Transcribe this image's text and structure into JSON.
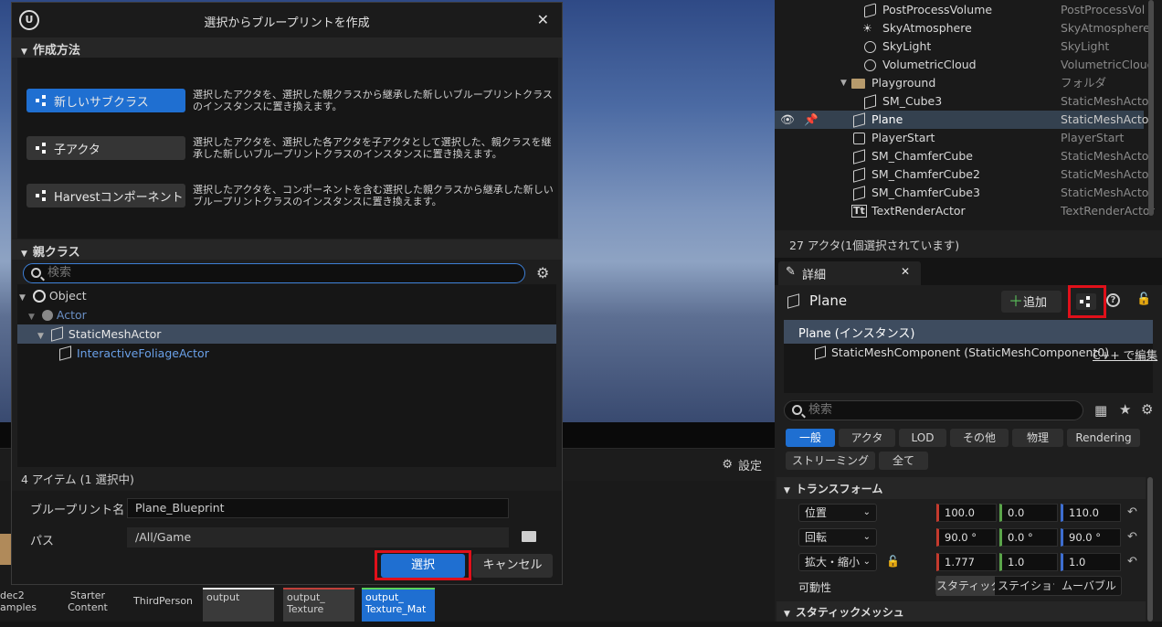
{
  "viewport": {
    "settings_label": "設定"
  },
  "content_tiles": [
    "dec2\namples",
    "Starter\nContent",
    "ThirdPerson",
    "output",
    "output_\nTexture",
    "output_\nTexture_Mat"
  ],
  "dialog": {
    "title": "選択からブループリントを作成",
    "section_method": "作成方法",
    "methods": [
      {
        "label": "新しいサブクラス",
        "desc": "選択したアクタを、選択した親クラスから継承した新しいブループリントクラスのインスタンスに置き換えます。"
      },
      {
        "label": "子アクタ",
        "desc": "選択したアクタを、選択した各アクタを子アクタとして選択した、親クラスを継承した新しいブループリントクラスのインスタンスに置き換えます。"
      },
      {
        "label": "Harvestコンポーネント",
        "desc": "選択したアクタを、コンポーネントを含む選択した親クラスから継承した新しいブループリントクラスのインスタンスに置き換えます。"
      }
    ],
    "section_parent": "親クラス",
    "search_placeholder": "検索",
    "tree": [
      "Object",
      "Actor",
      "StaticMeshActor",
      "InteractiveFoliageActor"
    ],
    "item_count": "4 アイテム (1 選択中)",
    "bp_name_label": "ブループリント名",
    "bp_name_value": "Plane_Blueprint",
    "path_label": "パス",
    "path_value": "/All/Game",
    "select_label": "選択",
    "cancel_label": "キャンセル"
  },
  "outliner": {
    "rows": [
      {
        "name": "PostProcessVolume",
        "type": "PostProcessVol"
      },
      {
        "name": "SkyAtmosphere",
        "type": "SkyAtmosphere"
      },
      {
        "name": "SkyLight",
        "type": "SkyLight"
      },
      {
        "name": "VolumetricCloud",
        "type": "VolumetricCloud"
      },
      {
        "name": "Playground",
        "type": "フォルダ"
      },
      {
        "name": "SM_Cube3",
        "type": "StaticMeshActor"
      },
      {
        "name": "Plane",
        "type": "StaticMeshActor"
      },
      {
        "name": "PlayerStart",
        "type": "PlayerStart"
      },
      {
        "name": "SM_ChamferCube",
        "type": "StaticMeshActor"
      },
      {
        "name": "SM_ChamferCube2",
        "type": "StaticMeshActor"
      },
      {
        "name": "SM_ChamferCube3",
        "type": "StaticMeshActor"
      },
      {
        "name": "TextRenderActor",
        "type": "TextRenderActor"
      }
    ],
    "status": "27 アクタ(1個選択されています)"
  },
  "details": {
    "tab_label": "詳細",
    "actor_name": "Plane",
    "add_label": "追加",
    "instance_label": "Plane (インスタンス)",
    "component_label": "StaticMeshComponent (StaticMeshComponent0)",
    "edit_cpp": "C++ で編集",
    "search_placeholder": "検索",
    "filters": [
      "一般",
      "アクタ",
      "LOD",
      "その他",
      "物理",
      "Rendering",
      "ストリーミング",
      "全て"
    ],
    "transform_header": "トランスフォーム",
    "location_label": "位置",
    "rotation_label": "回転",
    "scale_label": "拡大・縮小",
    "mobility_label": "可動性",
    "location": [
      "100.0",
      "0.0",
      "110.0"
    ],
    "rotation": [
      "90.0 °",
      "0.0 °",
      "90.0 °"
    ],
    "scale": [
      "1.777",
      "1.0",
      "1.0"
    ],
    "mobility_options": [
      "スタティック",
      "ステイショナリ",
      "ムーバブル"
    ],
    "static_mesh_header": "スタティックメッシュ"
  }
}
